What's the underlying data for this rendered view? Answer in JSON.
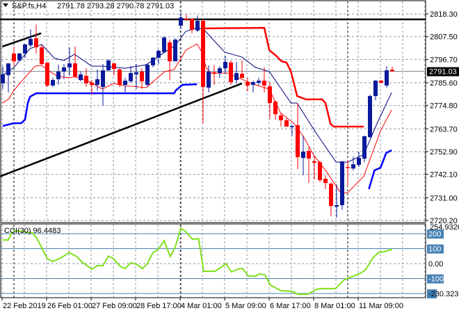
{
  "header": {
    "symbol": "S&P.fs,H4",
    "ohlc": "2791.78 2793.28 2790.78 2791.03",
    "menu_icon": "triangle-down-icon"
  },
  "colors": {
    "bull": "#0a1a9c",
    "bear": "#ff0000",
    "ma_fast": "#000080",
    "ma_slow": "#ff0000",
    "band_low": "#0000ff",
    "band_high": "#ff0000",
    "trend": "#000000",
    "cci": "#7fe01a",
    "level": "#4682b4",
    "grid": "#8a96a4"
  },
  "chart_data": {
    "type": "candlestick",
    "title": "S&P.fs,H4",
    "x_unit": "bar index (H4)",
    "current_price": 2791.03,
    "current_price_label": "2791.03",
    "price_axis": {
      "ylim": [
        2720.2,
        2818.3
      ],
      "ticks": [
        "2818.30",
        "2807.50",
        "2796.70",
        "2785.60",
        "2774.80",
        "2763.70",
        "2752.90",
        "2742.10",
        "2731.00",
        "2720.20"
      ]
    },
    "time_axis": {
      "labels": [
        "22 Feb 2019",
        "26 Feb 01:00",
        "27 Feb 09:00",
        "28 Feb 17:00",
        "4 Mar 01:00",
        "5 Mar 09:00",
        "6 Mar 17:00",
        "8 Mar 01:00",
        "11 Mar 09:00"
      ],
      "label_bar_index": [
        0,
        8,
        16,
        24,
        32,
        40,
        48,
        56,
        64
      ]
    },
    "candles_ohlc": [
      [
        2785.3,
        2793.5,
        2782.6,
        2789.6
      ],
      [
        2789.2,
        2794.8,
        2781.0,
        2794.8
      ],
      [
        2799.5,
        2802.8,
        2793.5,
        2795.8
      ],
      [
        2796.2,
        2799.8,
        2795.8,
        2799.5
      ],
      [
        2799.5,
        2804.1,
        2797.5,
        2803.8
      ],
      [
        2803.4,
        2811.0,
        2802.4,
        2806.4
      ],
      [
        2806.7,
        2813.3,
        2799.5,
        2802.4
      ],
      [
        2802.4,
        2803.8,
        2794.2,
        2794.5
      ],
      [
        2795.2,
        2795.2,
        2783.6,
        2784.3
      ],
      [
        2784.3,
        2787.9,
        2783.6,
        2786.9
      ],
      [
        2787.3,
        2794.2,
        2784.6,
        2790.9
      ],
      [
        2790.9,
        2794.5,
        2787.3,
        2792.9
      ],
      [
        2792.9,
        2802.4,
        2788.9,
        2794.8
      ],
      [
        2794.8,
        2802.8,
        2787.9,
        2788.6
      ],
      [
        2786.9,
        2790.9,
        2786.3,
        2789.6
      ],
      [
        2788.9,
        2792.5,
        2783.6,
        2785.3
      ],
      [
        2785.6,
        2786.9,
        2780.0,
        2784.6
      ],
      [
        2784.6,
        2791.9,
        2781.9,
        2787.3
      ],
      [
        2783.6,
        2794.5,
        2774.7,
        2791.5
      ],
      [
        2791.5,
        2796.8,
        2791.2,
        2796.2
      ],
      [
        2794.8,
        2795.2,
        2789.2,
        2792.2
      ],
      [
        2791.9,
        2792.5,
        2783.6,
        2784.6
      ],
      [
        2784.6,
        2787.9,
        2781.0,
        2786.6
      ],
      [
        2786.3,
        2793.5,
        2785.6,
        2790.2
      ],
      [
        2789.6,
        2794.5,
        2782.6,
        2790.6
      ],
      [
        2790.9,
        2792.5,
        2782.6,
        2786.3
      ],
      [
        2784.6,
        2794.5,
        2783.6,
        2794.2
      ],
      [
        2793.9,
        2797.8,
        2792.9,
        2797.5
      ],
      [
        2797.5,
        2801.5,
        2794.5,
        2800.8
      ],
      [
        2800.1,
        2807.7,
        2799.5,
        2807.1
      ],
      [
        2804.8,
        2806.1,
        2786.9,
        2795.8
      ],
      [
        2795.8,
        2806.7,
        2795.8,
        2806.1
      ],
      [
        2812.7,
        2819.0,
        2811.0,
        2816.6
      ],
      [
        2816.0,
        2818.0,
        2815.0,
        2815.7
      ],
      [
        2816.0,
        2816.0,
        2809.1,
        2810.7
      ],
      [
        2810.4,
        2817.6,
        2809.7,
        2815.0
      ],
      [
        2815.0,
        2816.0,
        2766.4,
        2783.6
      ],
      [
        2783.3,
        2793.9,
        2781.0,
        2790.9
      ],
      [
        2790.6,
        2793.9,
        2784.6,
        2789.9
      ],
      [
        2790.2,
        2793.5,
        2787.9,
        2792.5
      ],
      [
        2792.5,
        2798.5,
        2789.9,
        2795.5
      ],
      [
        2795.2,
        2796.2,
        2784.6,
        2785.9
      ],
      [
        2786.9,
        2795.5,
        2785.3,
        2790.2
      ],
      [
        2789.9,
        2796.2,
        2787.9,
        2787.9
      ],
      [
        2785.9,
        2787.9,
        2781.6,
        2784.3
      ],
      [
        2784.6,
        2786.6,
        2781.0,
        2785.9
      ],
      [
        2785.6,
        2787.9,
        2784.3,
        2786.6
      ],
      [
        2786.6,
        2792.9,
        2781.0,
        2784.3
      ],
      [
        2783.9,
        2785.9,
        2768.4,
        2776.0
      ],
      [
        2776.7,
        2777.0,
        2768.1,
        2770.7
      ],
      [
        2770.1,
        2771.4,
        2764.8,
        2767.8
      ],
      [
        2767.8,
        2768.8,
        2764.8,
        2764.8
      ],
      [
        2764.8,
        2765.5,
        2760.5,
        2765.1
      ],
      [
        2765.5,
        2776.0,
        2744.6,
        2750.3
      ],
      [
        2749.9,
        2760.5,
        2741.7,
        2752.9
      ],
      [
        2753.2,
        2754.9,
        2738.0,
        2749.6
      ],
      [
        2748.3,
        2750.6,
        2739.7,
        2747.6
      ],
      [
        2747.9,
        2748.6,
        2738.4,
        2739.4
      ],
      [
        2740.0,
        2741.7,
        2735.1,
        2738.0
      ],
      [
        2737.7,
        2738.4,
        2722.2,
        2727.1
      ],
      [
        2726.8,
        2737.4,
        2721.6,
        2727.5
      ],
      [
        2727.5,
        2748.3,
        2725.2,
        2748.3
      ],
      [
        2745.6,
        2748.6,
        2736.4,
        2745.3
      ],
      [
        2744.9,
        2750.6,
        2743.9,
        2746.9
      ],
      [
        2746.6,
        2752.9,
        2745.6,
        2749.9
      ],
      [
        2749.6,
        2760.5,
        2747.9,
        2760.2
      ],
      [
        2759.8,
        2780.0,
        2759.5,
        2779.3
      ],
      [
        2779.3,
        2786.9,
        2777.3,
        2786.6
      ],
      [
        2786.6,
        2786.9,
        2785.3,
        2785.6
      ],
      [
        2784.3,
        2793.5,
        2783.3,
        2791.5
      ],
      [
        2791.78,
        2793.28,
        2790.78,
        2791.03
      ]
    ],
    "series": [
      {
        "name": "MA fast",
        "points": [
          [
            0,
            2789.2
          ],
          [
            2,
            2792.9
          ],
          [
            4.9,
            2801.8
          ],
          [
            7,
            2803.8
          ],
          [
            9.3,
            2797.2
          ],
          [
            11,
            2796.2
          ],
          [
            12.9,
            2799.1
          ],
          [
            16,
            2793.5
          ],
          [
            17.9,
            2793.5
          ],
          [
            22,
            2792.5
          ],
          [
            25.8,
            2794.2
          ],
          [
            29.1,
            2800.1
          ],
          [
            31,
            2803.4
          ],
          [
            32.9,
            2810.0
          ],
          [
            34.9,
            2811.7
          ],
          [
            36.1,
            2811.0
          ],
          [
            39.9,
            2800.1
          ],
          [
            43,
            2797.8
          ],
          [
            45.4,
            2792.9
          ],
          [
            47.9,
            2790.9
          ],
          [
            51.8,
            2776.0
          ],
          [
            52.9,
            2776.0
          ],
          [
            55.8,
            2763.8
          ],
          [
            59.9,
            2747.9
          ],
          [
            62,
            2747.9
          ],
          [
            64.9,
            2751.6
          ],
          [
            67.4,
            2767.1
          ],
          [
            69.9,
            2781.0
          ]
        ]
      },
      {
        "name": "MA slow",
        "points": [
          [
            0,
            2776.0
          ],
          [
            1.1,
            2778.0
          ],
          [
            2,
            2782.0
          ],
          [
            3.6,
            2786.9
          ],
          [
            5.8,
            2793.5
          ],
          [
            7,
            2793.9
          ],
          [
            8.3,
            2791.2
          ],
          [
            9.9,
            2788.6
          ],
          [
            12,
            2787.9
          ],
          [
            12.9,
            2788.6
          ],
          [
            15.4,
            2786.3
          ],
          [
            17.9,
            2782.6
          ],
          [
            19.9,
            2785.3
          ],
          [
            21.6,
            2784.3
          ],
          [
            25.8,
            2783.3
          ],
          [
            29.1,
            2790.9
          ],
          [
            30.8,
            2791.9
          ],
          [
            32.9,
            2801.1
          ],
          [
            34.9,
            2804.1
          ],
          [
            35.8,
            2800.1
          ],
          [
            36.6,
            2792.5
          ],
          [
            37.4,
            2790.2
          ],
          [
            40.4,
            2790.2
          ],
          [
            43.3,
            2786.9
          ],
          [
            45.4,
            2784.6
          ],
          [
            47.9,
            2782.6
          ],
          [
            49.9,
            2771.4
          ],
          [
            52.4,
            2766.1
          ],
          [
            54.1,
            2759.8
          ],
          [
            55.8,
            2751.6
          ],
          [
            58.3,
            2743.0
          ],
          [
            60.8,
            2733.1
          ],
          [
            62,
            2733.4
          ],
          [
            64.9,
            2741.3
          ],
          [
            67.9,
            2762.8
          ],
          [
            69.9,
            2772.7
          ]
        ]
      },
      {
        "name": "Lower band A",
        "points": [
          [
            0,
            2765.1
          ],
          [
            2,
            2766.4
          ],
          [
            3.3,
            2766.4
          ],
          [
            4,
            2768.1
          ],
          [
            4.5,
            2776.0
          ],
          [
            4.9,
            2779.0
          ],
          [
            6,
            2780.6
          ],
          [
            30.8,
            2780.6
          ],
          [
            31.1,
            2782.0
          ],
          [
            32.3,
            2784.6
          ],
          [
            34.9,
            2784.9
          ]
        ]
      },
      {
        "name": "Lower band B",
        "points": [
          [
            65.8,
            2735.1
          ],
          [
            66.8,
            2744.0
          ],
          [
            67.9,
            2745.3
          ],
          [
            68.9,
            2752.2
          ],
          [
            69.9,
            2753.6
          ]
        ]
      },
      {
        "name": "Upper band",
        "points": [
          [
            35.8,
            2811.4
          ],
          [
            47,
            2811.7
          ],
          [
            47.9,
            2801.1
          ],
          [
            49.1,
            2798.5
          ],
          [
            50.1,
            2795.8
          ],
          [
            51,
            2795.2
          ],
          [
            51.8,
            2790.9
          ],
          [
            52.9,
            2779.3
          ],
          [
            54.5,
            2777.7
          ],
          [
            57.4,
            2777.7
          ],
          [
            58,
            2776.0
          ],
          [
            58.9,
            2766.1
          ],
          [
            59.5,
            2764.8
          ],
          [
            64.9,
            2764.8
          ]
        ]
      }
    ],
    "trendlines": [
      {
        "name": "resistance",
        "points": [
          [
            -0.5,
            2815.7
          ],
          [
            76,
            2815.7
          ]
        ]
      },
      {
        "name": "short channel",
        "points": [
          [
            -0.1,
            2802.8
          ],
          [
            6.9,
            2809.1
          ]
        ]
      },
      {
        "name": "rising support",
        "points": [
          [
            -0.5,
            2741.1
          ],
          [
            43,
            2785.3
          ]
        ]
      }
    ],
    "cci": {
      "label": "CCI(30) 96.4483",
      "period": 30,
      "last": 96.4483,
      "max_label": "254.9326",
      "min_label": "-230.3237",
      "ylim": [
        -230.3237,
        254.9326
      ],
      "levels": [
        200,
        100,
        -100,
        -200
      ],
      "axis_labels": [
        "200",
        "100",
        "0.00",
        "-100"
      ],
      "points": [
        [
          0,
          158
        ],
        [
          1,
          158
        ],
        [
          1.6,
          205
        ],
        [
          2.4,
          219
        ],
        [
          5.3,
          205
        ],
        [
          6.1,
          172
        ],
        [
          8,
          33
        ],
        [
          9,
          14
        ],
        [
          10.6,
          42
        ],
        [
          11.9,
          74
        ],
        [
          13.3,
          47
        ],
        [
          14.3,
          9
        ],
        [
          16,
          -37
        ],
        [
          17,
          -14
        ],
        [
          18,
          -14
        ],
        [
          19,
          51
        ],
        [
          19.9,
          33
        ],
        [
          21.1,
          -19
        ],
        [
          22,
          -33
        ],
        [
          23,
          5
        ],
        [
          24.1,
          -5
        ],
        [
          25.1,
          -33
        ],
        [
          25.9,
          -5
        ],
        [
          27,
          74
        ],
        [
          28,
          98
        ],
        [
          29,
          153
        ],
        [
          30.1,
          47
        ],
        [
          31,
          112
        ],
        [
          32,
          237
        ],
        [
          32.9,
          214
        ],
        [
          34.1,
          163
        ],
        [
          35.2,
          167
        ],
        [
          36.1,
          -51
        ],
        [
          38.1,
          -51
        ],
        [
          39.1,
          -28
        ],
        [
          40.1,
          0
        ],
        [
          41.1,
          -56
        ],
        [
          42.2,
          -37
        ],
        [
          43.1,
          -33
        ],
        [
          44.2,
          -84
        ],
        [
          45.5,
          -84
        ],
        [
          46,
          -70
        ],
        [
          47.1,
          -74
        ],
        [
          48.1,
          -144
        ],
        [
          50,
          -181
        ],
        [
          52.1,
          -186
        ],
        [
          53.1,
          -205
        ],
        [
          54.8,
          -205
        ],
        [
          56.4,
          -172
        ],
        [
          57.4,
          -167
        ],
        [
          59.8,
          -167
        ],
        [
          61.4,
          -107
        ],
        [
          63,
          -84
        ],
        [
          64.5,
          -60
        ],
        [
          65.3,
          -37
        ],
        [
          66.4,
          33
        ],
        [
          67.5,
          74
        ],
        [
          68.5,
          79
        ],
        [
          70,
          96.4
        ]
      ]
    }
  }
}
